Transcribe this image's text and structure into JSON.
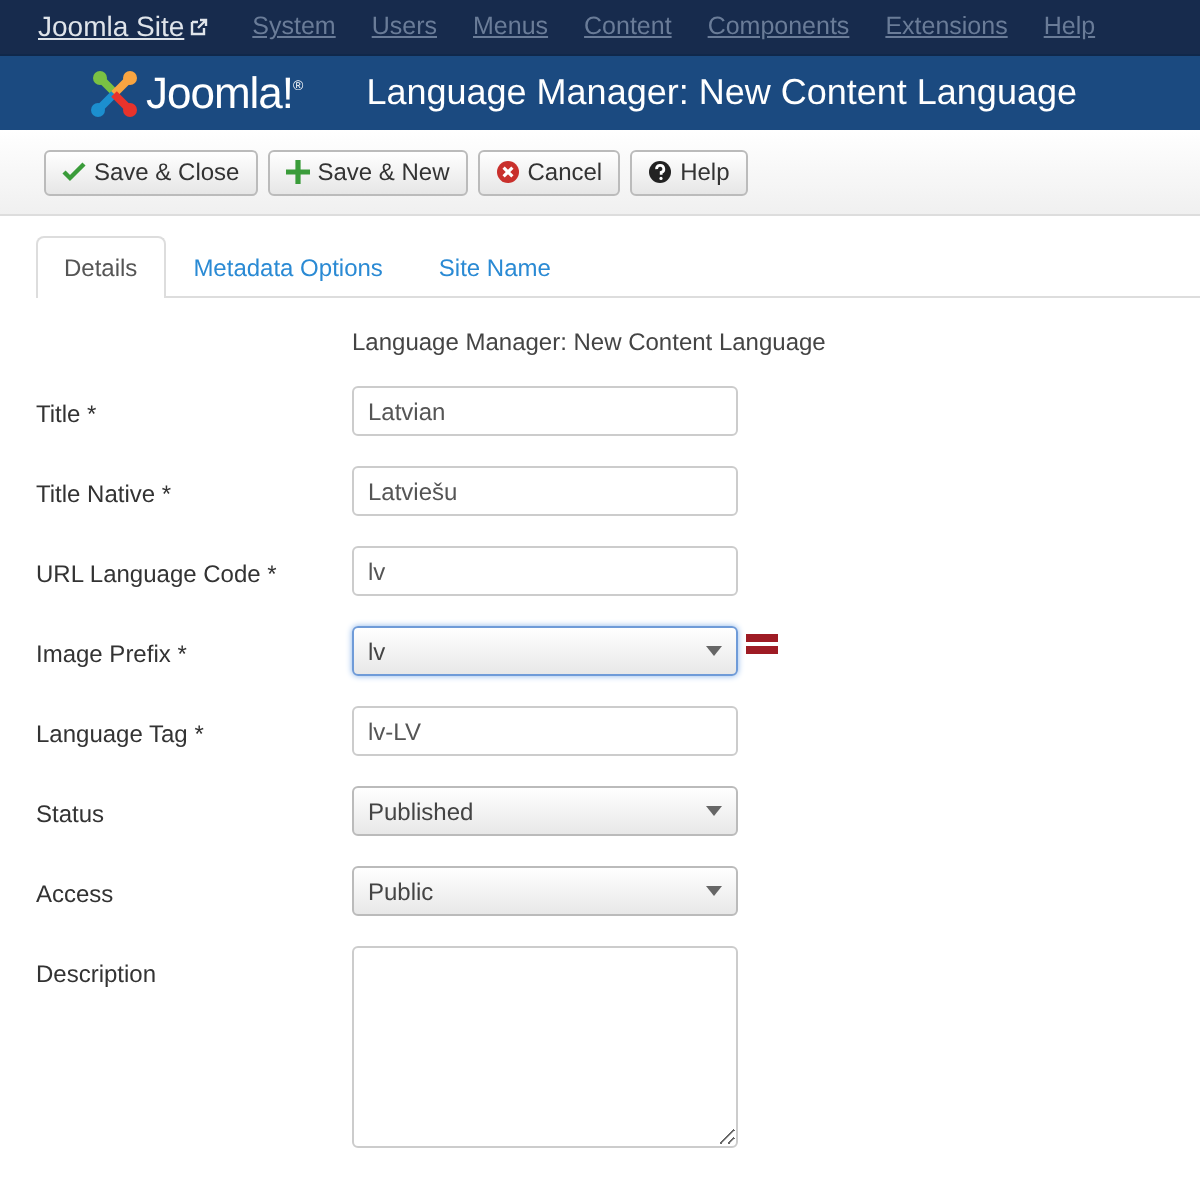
{
  "topbar": {
    "site": "Joomla Site",
    "menu": [
      "System",
      "Users",
      "Menus",
      "Content",
      "Components",
      "Extensions",
      "Help"
    ]
  },
  "header": {
    "logo": "Joomla!$^{®}$",
    "title": "Language Manager: New Content Language"
  },
  "toolbar": [
    {
      "kind": "check",
      "label": "Save & Close"
    },
    {
      "kind": "plus",
      "label": "Save & New"
    },
    {
      "kind": "cancel",
      "label": "Cancel"
    },
    {
      "kind": "help",
      "label": "Help"
    }
  ],
  "tabs": [
    {
      "label": "Details",
      "selected": true
    },
    {
      "label": "Metadata Options",
      "selected": false
    },
    {
      "label": "Site Name",
      "selected": false
    }
  ],
  "form_heading": "Language Manager: New Content Language",
  "fields": [
    {
      "kind": "text",
      "label": "Title *",
      "value": "Latvian",
      "focused": false
    },
    {
      "kind": "text",
      "label": "Title Native *",
      "value": "Latviešu",
      "focused": false
    },
    {
      "kind": "text",
      "label": "URL Language Code *",
      "value": "lv",
      "focused": false
    },
    {
      "kind": "select",
      "label": "Image Prefix *",
      "value": "lv",
      "focused": true,
      "flag": true
    },
    {
      "kind": "text",
      "label": "Language Tag *",
      "value": "lv-LV",
      "focused": false
    },
    {
      "kind": "select",
      "label": "Status",
      "value": "Published",
      "focused": false
    },
    {
      "kind": "select",
      "label": "Access",
      "value": "Public",
      "focused": false
    },
    {
      "kind": "textarea",
      "label": "Description",
      "focused": false
    }
  ]
}
